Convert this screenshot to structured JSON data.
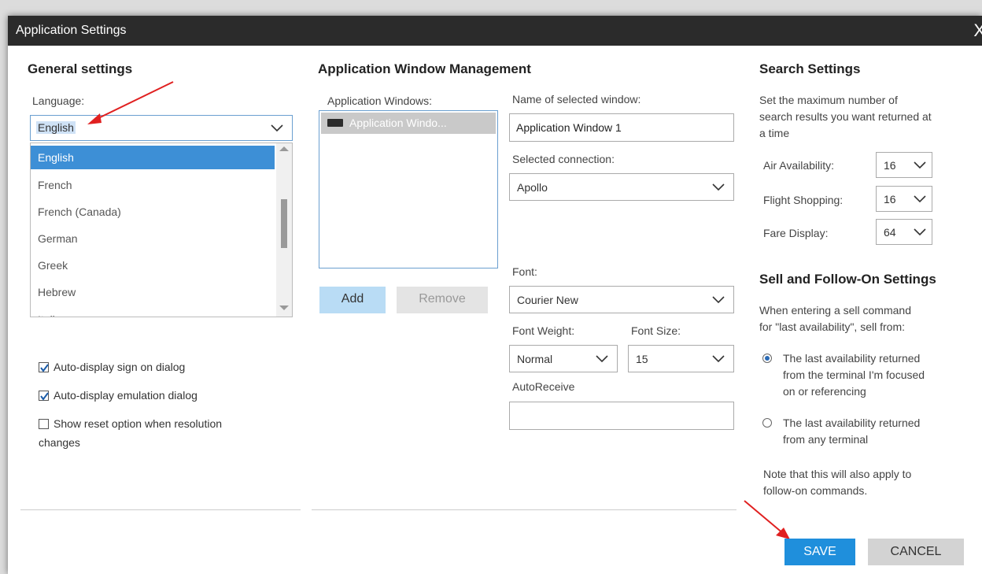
{
  "window": {
    "title": "Application Settings",
    "close_glyph": "X"
  },
  "general": {
    "heading": "General settings",
    "language_label": "Language:",
    "language_value": "English",
    "language_options": [
      "English",
      "French",
      "French (Canada)",
      "German",
      "Greek",
      "Hebrew",
      "Italian"
    ],
    "checkboxes": [
      {
        "label": "Auto-display sign on dialog",
        "checked": true
      },
      {
        "label": "Auto-display emulation dialog",
        "checked": true
      },
      {
        "label": "Show reset option when resolution",
        "label2": "changes",
        "checked": false
      }
    ]
  },
  "awm": {
    "heading": "Application Window Management",
    "windows_label": "Application Windows:",
    "windows": [
      "Application Windo..."
    ],
    "add_label": "Add",
    "remove_label": "Remove",
    "name_label": "Name of selected window:",
    "name_value": "Application Window 1",
    "connection_label": "Selected connection:",
    "connection_value": "Apollo",
    "font_label": "Font:",
    "font_value": "Courier New",
    "weight_label": "Font Weight:",
    "weight_value": "Normal",
    "size_label": "Font Size:",
    "size_value": "15",
    "autoreceive_label": "AutoReceive",
    "autoreceive_value": ""
  },
  "search": {
    "heading": "Search Settings",
    "desc": [
      "Set the maximum number of",
      "search results you want returned at",
      "a time"
    ],
    "rows": [
      {
        "label": "Air Availability:",
        "value": "16"
      },
      {
        "label": "Flight Shopping:",
        "value": "16"
      },
      {
        "label": "Fare Display:",
        "value": "64"
      }
    ]
  },
  "sell": {
    "heading": "Sell and Follow-On Settings",
    "desc": [
      "When entering a sell command",
      "for \"last availability\", sell from:"
    ],
    "options": [
      {
        "lines": [
          "The last availability returned",
          "from the terminal I'm focused",
          "on or referencing"
        ],
        "selected": true
      },
      {
        "lines": [
          "The last availability returned",
          "from any terminal"
        ],
        "selected": false
      }
    ],
    "note": [
      "Note that this will also apply to",
      "follow-on commands."
    ]
  },
  "footer": {
    "save_label": "SAVE",
    "cancel_label": "CANCEL"
  },
  "colors": {
    "title_bar": "#2b2b2b",
    "accent": "#3d8fd6",
    "save_button": "#1f8fdc",
    "annotation_arrow": "#e02020"
  }
}
